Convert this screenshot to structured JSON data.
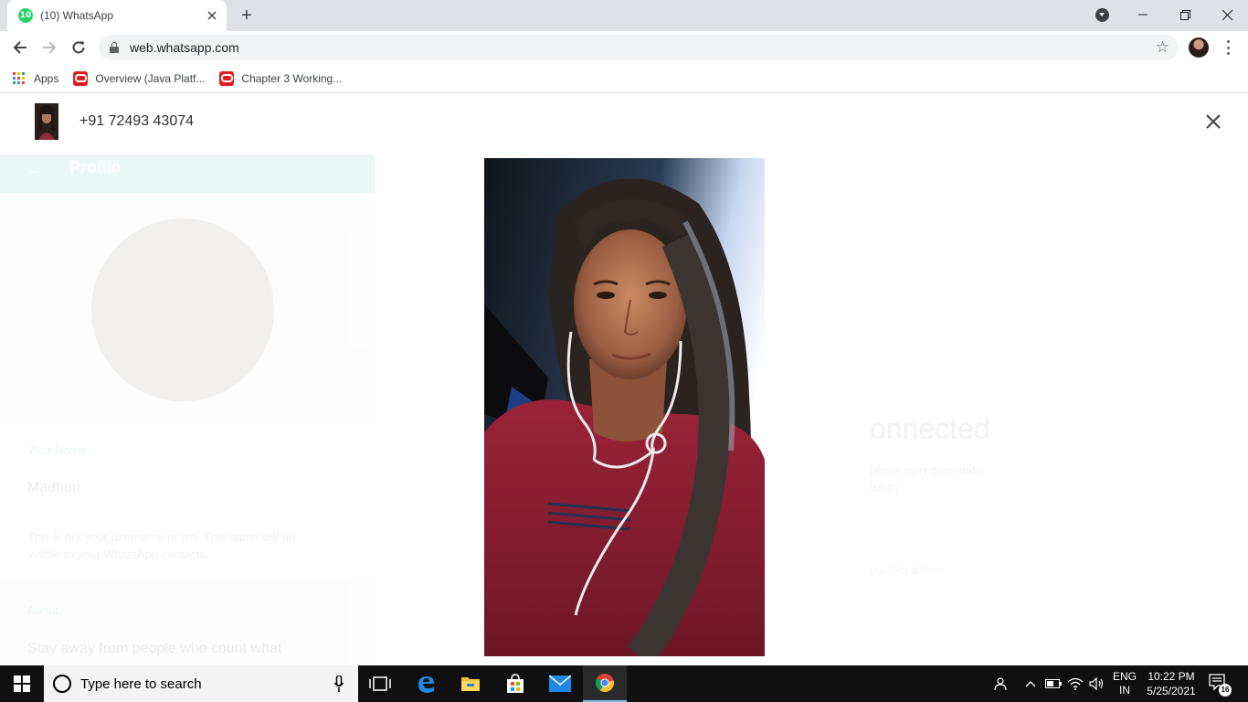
{
  "browser": {
    "tab": {
      "favicon_badge": "10",
      "title": "(10) WhatsApp"
    },
    "url": "web.whatsapp.com",
    "bookmarks": [
      {
        "label": "Apps",
        "icon": "apps-grid-icon"
      },
      {
        "label": "Overview (Java Platf...",
        "icon": "oracle-icon"
      },
      {
        "label": "Chapter 3 Working...",
        "icon": "oracle-icon"
      }
    ]
  },
  "background": {
    "sidebar_title": "Profile",
    "name_label": "Your Name",
    "name_value": "Madhuri",
    "name_note": "This is not your username or pin. This name will be visible to your WhatsApp contacts.",
    "about_label": "About",
    "about_value": "Stay away from people who count what",
    "connected_text": "onnected",
    "connected_sub1": "phone to reduce data",
    "connected_sub2": "Wi-Fi.",
    "calls_text": "ou. Get it here."
  },
  "viewer": {
    "contact_name": "+91 72493 43074"
  },
  "taskbar": {
    "search_placeholder": "Type here to search",
    "lang_top": "ENG",
    "lang_bottom": "IN",
    "time": "10:22 PM",
    "date": "5/25/2021",
    "notification_count": "16"
  },
  "colors": {
    "whatsapp_green": "#25d366",
    "teal": "#00bfa5",
    "taskbar": "#101010"
  }
}
